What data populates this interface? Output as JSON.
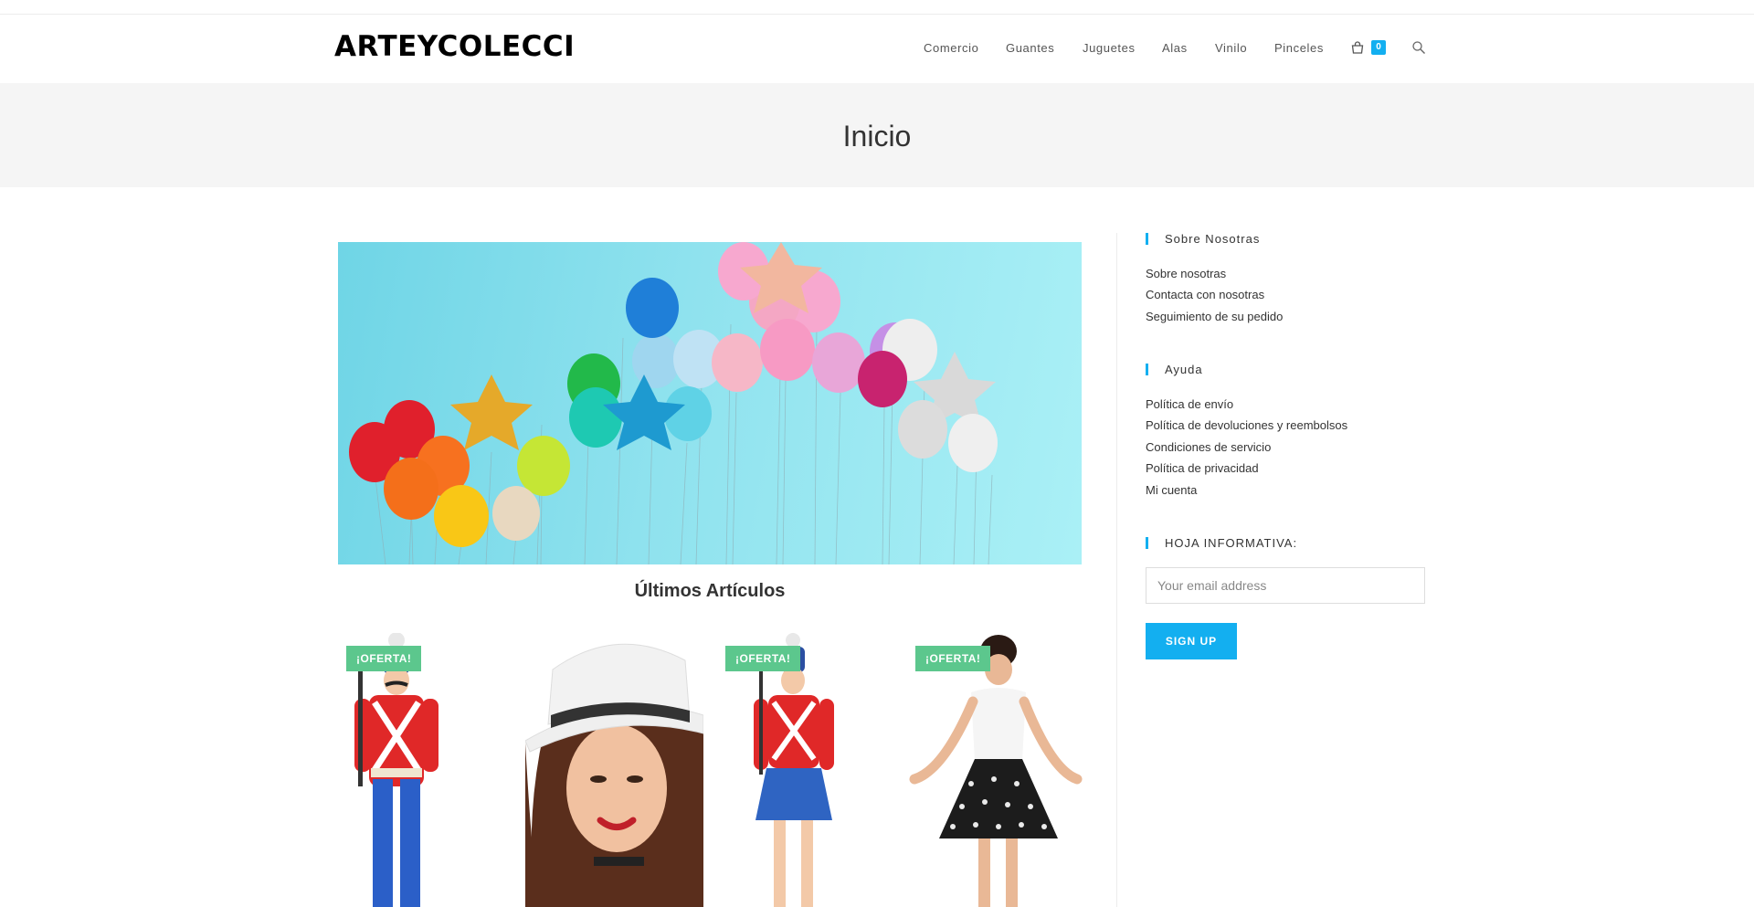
{
  "site": {
    "logo": "ARTEYCOLECCI"
  },
  "nav": {
    "items": [
      "Comercio",
      "Guantes",
      "Juguetes",
      "Alas",
      "Vinilo",
      "Pinceles"
    ],
    "cart_count": "0",
    "cart_icon": "shopping-bag-icon",
    "search_icon": "search-icon"
  },
  "page": {
    "title": "Inicio"
  },
  "main": {
    "section_title": "Últimos Artículos",
    "products": [
      {
        "badge": "¡OFERTA!"
      },
      {
        "badge": ""
      },
      {
        "badge": "¡OFERTA!"
      },
      {
        "badge": "¡OFERTA!"
      }
    ]
  },
  "sidebar": {
    "about_title": "Sobre Nosotras",
    "about_links": [
      "Sobre nosotras",
      "Contacta con nosotras",
      "Seguimiento de su pedido"
    ],
    "help_title": "Ayuda",
    "help_links": [
      "Política de envío",
      "Política de devoluciones y reembolsos",
      "Condiciones de servicio",
      "Política de privacidad",
      "Mi cuenta"
    ],
    "newsletter_title": "HOJA INFORMATIVA:",
    "email_placeholder": "Your email address",
    "signup_label": "SIGN UP"
  },
  "colors": {
    "accent": "#13aff0",
    "sale_badge": "#5cc78d",
    "page_header_bg": "#f5f5f5"
  }
}
